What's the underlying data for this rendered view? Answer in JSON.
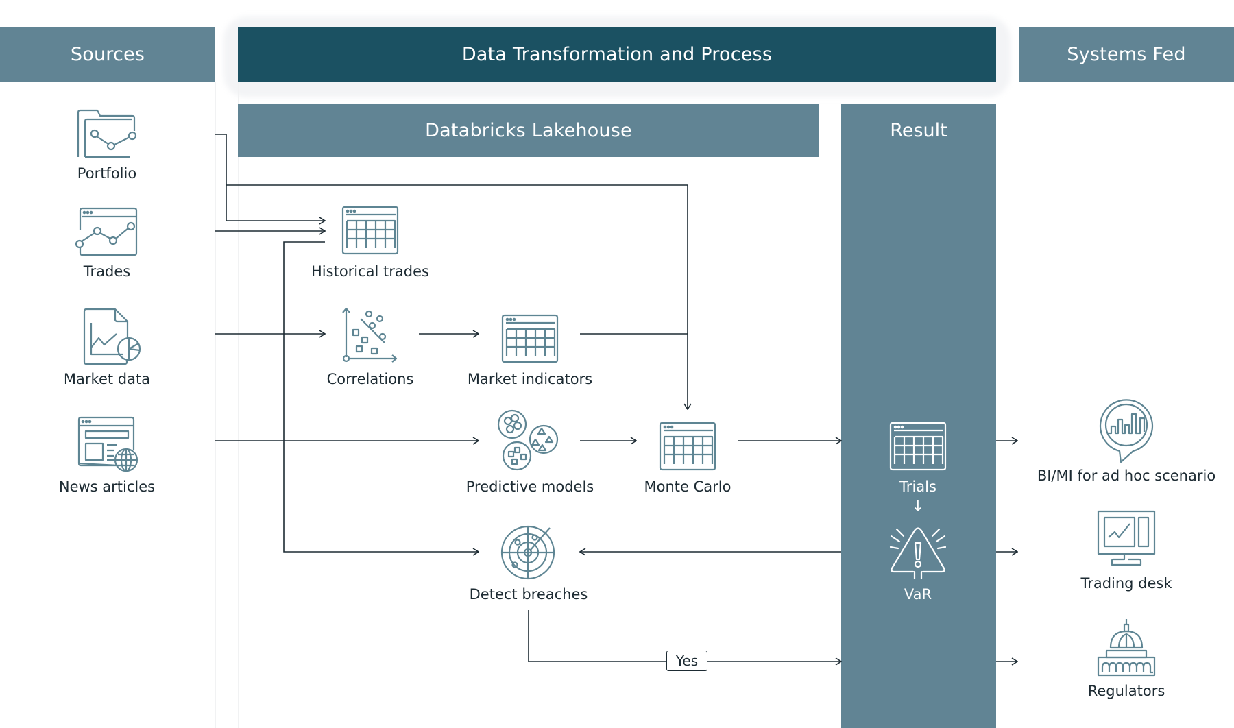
{
  "headers": {
    "sources": "Sources",
    "process": "Data Transformation and Process",
    "systems_fed": "Systems Fed",
    "lakehouse": "Databricks Lakehouse",
    "result": "Result"
  },
  "sources": [
    {
      "label": "Portfolio",
      "icon": "folder-chart-icon"
    },
    {
      "label": "Trades",
      "icon": "browser-line-chart-icon"
    },
    {
      "label": "Market data",
      "icon": "document-chart-icon"
    },
    {
      "label": "News articles",
      "icon": "news-globe-icon"
    }
  ],
  "processing": {
    "historical_trades": "Historical trades",
    "correlations": "Correlations",
    "market_indicators": "Market indicators",
    "predictive_models": "Predictive models",
    "monte_carlo": "Monte Carlo",
    "detect_breaches": "Detect breaches",
    "yes_label": "Yes"
  },
  "result": {
    "trials": "Trials",
    "arrow": "↓",
    "var": "VaR"
  },
  "systems_fed": [
    {
      "label": "BI/MI for ad hoc scenario",
      "icon": "chart-speech-bubble-icon"
    },
    {
      "label": "Trading desk",
      "icon": "monitor-chart-icon"
    },
    {
      "label": "Regulators",
      "icon": "capitol-building-icon"
    }
  ],
  "colors": {
    "header_light": "#618494",
    "header_dark": "#1b5162",
    "icon_stroke": "#5e8593",
    "line": "#1d2b33"
  }
}
